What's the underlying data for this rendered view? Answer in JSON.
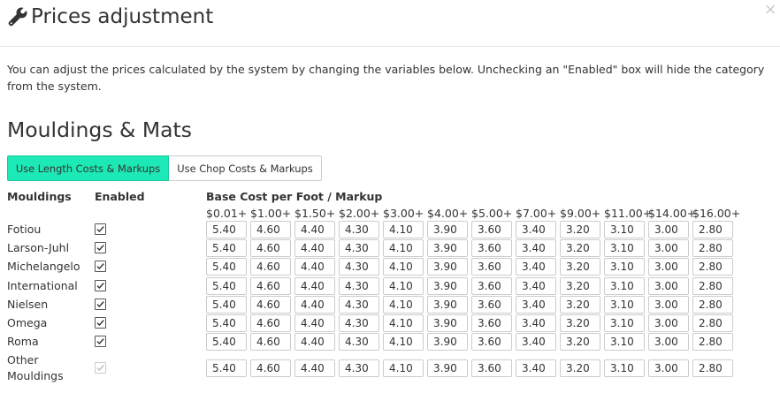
{
  "header": {
    "title": "Prices adjustment",
    "close": "×"
  },
  "description": "You can adjust the prices calculated by the system by changing the variables below. Unchecking an \"Enabled\" box will hide the category from the system.",
  "section_title": "Mouldings & Mats",
  "toggle": {
    "active": "Use Length Costs & Markups",
    "inactive": "Use Chop Costs & Markups"
  },
  "columns": {
    "mouldings": "Mouldings",
    "enabled": "Enabled",
    "base_cost": "Base Cost per Foot / Markup"
  },
  "brackets": [
    "$0.01+",
    "$1.00+",
    "$1.50+",
    "$2.00+",
    "$3.00+",
    "$4.00+",
    "$5.00+",
    "$7.00+",
    "$9.00+",
    "$11.00+",
    "$14.00+",
    "$16.00+"
  ],
  "rows": [
    {
      "name": "Fotiou",
      "enabled": true,
      "values": [
        "5.40",
        "4.60",
        "4.40",
        "4.30",
        "4.10",
        "3.90",
        "3.60",
        "3.40",
        "3.20",
        "3.10",
        "3.00",
        "2.80"
      ]
    },
    {
      "name": "Larson-Juhl",
      "enabled": true,
      "values": [
        "5.40",
        "4.60",
        "4.40",
        "4.30",
        "4.10",
        "3.90",
        "3.60",
        "3.40",
        "3.20",
        "3.10",
        "3.00",
        "2.80"
      ]
    },
    {
      "name": "Michelangelo",
      "enabled": true,
      "values": [
        "5.40",
        "4.60",
        "4.40",
        "4.30",
        "4.10",
        "3.90",
        "3.60",
        "3.40",
        "3.20",
        "3.10",
        "3.00",
        "2.80"
      ]
    },
    {
      "name": "International",
      "enabled": true,
      "values": [
        "5.40",
        "4.60",
        "4.40",
        "4.30",
        "4.10",
        "3.90",
        "3.60",
        "3.40",
        "3.20",
        "3.10",
        "3.00",
        "2.80"
      ]
    },
    {
      "name": "Nielsen",
      "enabled": true,
      "values": [
        "5.40",
        "4.60",
        "4.40",
        "4.30",
        "4.10",
        "3.90",
        "3.60",
        "3.40",
        "3.20",
        "3.10",
        "3.00",
        "2.80"
      ]
    },
    {
      "name": "Omega",
      "enabled": true,
      "values": [
        "5.40",
        "4.60",
        "4.40",
        "4.30",
        "4.10",
        "3.90",
        "3.60",
        "3.40",
        "3.20",
        "3.10",
        "3.00",
        "2.80"
      ]
    },
    {
      "name": "Roma",
      "enabled": true,
      "values": [
        "5.40",
        "4.60",
        "4.40",
        "4.30",
        "4.10",
        "3.90",
        "3.60",
        "3.40",
        "3.20",
        "3.10",
        "3.00",
        "2.80"
      ]
    },
    {
      "name": "Other Mouldings",
      "name_lines": [
        "Other",
        "Mouldings"
      ],
      "enabled": true,
      "disabled": true,
      "values": [
        "5.40",
        "4.60",
        "4.40",
        "4.30",
        "4.10",
        "3.90",
        "3.60",
        "3.40",
        "3.20",
        "3.10",
        "3.00",
        "2.80"
      ]
    }
  ],
  "colors": {
    "accent": "#1de9b6",
    "text": "#333333",
    "border": "#cccccc"
  },
  "icons": {
    "title_icon": "wrench-icon",
    "close_icon": "close-icon",
    "checkbox_icon": "checkmark-icon"
  }
}
